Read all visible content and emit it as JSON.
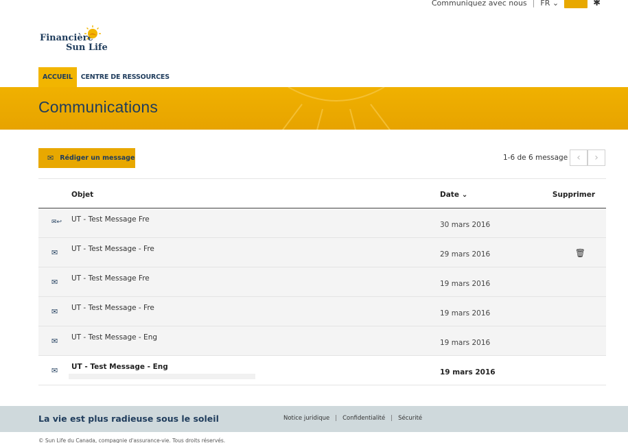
{
  "utility": {
    "contact": "Communiquez avec nous",
    "lang": "FR",
    "lang_chevron": "⌄",
    "sep": "|"
  },
  "logo": {
    "line1": "Financière",
    "line2": "Sun Life"
  },
  "nav": {
    "items": [
      {
        "label": "ACCUEIL",
        "active": true
      },
      {
        "label": "CENTRE DE RESSOURCES",
        "active": false
      }
    ]
  },
  "banner": {
    "title": "Communications"
  },
  "toolbar": {
    "compose_label": "Rédiger un message",
    "pager_text": "1-6 de 6 message",
    "prev_icon": "chevron-left-icon",
    "next_icon": "chevron-right-icon"
  },
  "table": {
    "headers": {
      "subject": "Objet",
      "date": "Date",
      "delete": "Supprimer"
    },
    "rows": [
      {
        "subject": "UT - Test Message Fre",
        "date": "30 mars 2016",
        "icon": "envelope-reply-icon",
        "deletable": false,
        "unread": false
      },
      {
        "subject": "UT - Test Message - Fre",
        "date": "29 mars 2016",
        "icon": "envelope-icon",
        "deletable": true,
        "unread": false
      },
      {
        "subject": "UT - Test Message Fre",
        "date": "19 mars 2016",
        "icon": "envelope-icon",
        "deletable": false,
        "unread": false
      },
      {
        "subject": "UT - Test Message - Fre",
        "date": "19 mars 2016",
        "icon": "envelope-icon",
        "deletable": false,
        "unread": false
      },
      {
        "subject": "UT - Test Message - Eng",
        "date": "19 mars 2016",
        "icon": "envelope-icon",
        "deletable": false,
        "unread": false
      },
      {
        "subject": "UT - Test Message - Eng",
        "date": "19 mars 2016",
        "icon": "envelope-icon",
        "deletable": false,
        "unread": true
      }
    ]
  },
  "footer": {
    "slogan": "La vie est plus radieuse sous le soleil",
    "links": [
      "Notice juridique",
      "Confidentialité",
      "Sécurité"
    ],
    "copyright": "© Sun Life du Canada, compagnie d'assurance-vie. Tous droits réservés."
  },
  "colors": {
    "accent": "#e8a800",
    "navy": "#1f3c5c",
    "footer_bg": "#cfd9dc"
  }
}
